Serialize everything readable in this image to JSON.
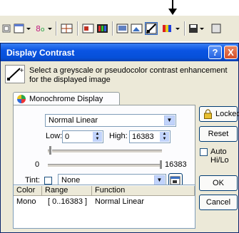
{
  "toolbar": {
    "icons": [
      "window-icon",
      "color-palette-icon",
      "split-view-icon",
      "image-icon",
      "color-bars-icon",
      "overlay-icon",
      "contrast-icon",
      "pseudocolor-icon",
      "save-icon"
    ]
  },
  "dialog": {
    "title": "Display Contrast",
    "help_label": "?",
    "close_label": "X",
    "description": "Select a greyscale or pseudocolor contrast enhancement for the displayed image",
    "tab_label": "Monochrome Display",
    "mode": "Normal Linear",
    "low_label": "Low:",
    "low_value": "0",
    "high_label": "High:",
    "high_value": "16383",
    "range_min": "0",
    "range_max": "16383",
    "tint_label": "Tint:",
    "tint_value": "None",
    "locked_label": "Locked",
    "reset_label": "Reset",
    "auto_label": "Auto Hi/Lo",
    "ok_label": "OK",
    "cancel_label": "Cancel",
    "list": {
      "headers": [
        "Color",
        "Range",
        "Function"
      ],
      "rows": [
        [
          "Mono",
          "[ 0..16383 ]",
          "Normal Linear"
        ]
      ]
    }
  }
}
